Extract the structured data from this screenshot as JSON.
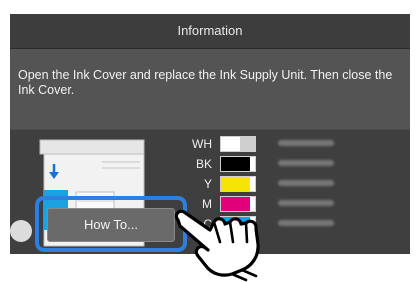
{
  "dialog": {
    "title": "Information",
    "message": "Open the Ink Cover and replace the Ink Supply Unit. Then close the Ink Cover."
  },
  "inks": [
    {
      "label": "WH",
      "color": "#ffffff",
      "level": 0.55
    },
    {
      "label": "BK",
      "color": "#000000",
      "level": 0.85
    },
    {
      "label": "Y",
      "color": "#f5e400",
      "level": 0.85
    },
    {
      "label": "M",
      "color": "#e2007a",
      "level": 0.85
    },
    {
      "label": "C",
      "color": "#00a8e1",
      "level": 0.85
    }
  ],
  "buttons": {
    "how_to": "How To..."
  },
  "colors": {
    "highlight": "#2f7fe0",
    "printer_accent": "#1aa3e0"
  },
  "icons": [
    "arrow-down-icon",
    "info-icon",
    "pointing-hand-icon"
  ]
}
